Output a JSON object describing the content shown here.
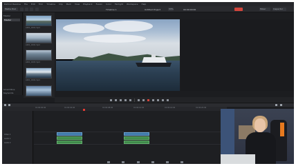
{
  "window": {
    "title": "DaVinci Resolve"
  },
  "menubar": {
    "items": [
      "DaVinci Resolve",
      "File",
      "Edit",
      "Trim",
      "Timeline",
      "Clip",
      "Mark",
      "View",
      "Playback",
      "Fusion",
      "Color",
      "Fairlight",
      "Workspace",
      "Help"
    ]
  },
  "toolbar": {
    "media_pool": "Media Pool",
    "project_title": "Untitled Project",
    "timeline_name": "Timeline 1",
    "zoom": "33%",
    "timecode_top": "00:00:00:00",
    "inspector": "Inspector",
    "mixer": "Mixer"
  },
  "left_panel": {
    "master_label": "Master",
    "items": [
      "Master"
    ],
    "smart_bins_label": "Smart Bins",
    "smart_items": [
      "Keywords",
      "Collections"
    ]
  },
  "bin": {
    "clips": [
      {
        "label": "A001_C001.mp4"
      },
      {
        "label": "A001_C002.mp4"
      },
      {
        "label": "A001_C003.mp4"
      },
      {
        "label": "A001_C004.mp4"
      },
      {
        "label": "A001_C005.mp4"
      }
    ]
  },
  "timeline": {
    "timecode": "01:00:00:00",
    "ruler_labels": [
      "01:00:00:00",
      "01:00:04:00",
      "01:00:08:00",
      "01:00:12:00",
      "01:00:16:00",
      "01:00:20:00"
    ],
    "tracks": [
      {
        "name": "V1",
        "label": "Video 1"
      },
      {
        "name": "A1",
        "label": "Audio 1"
      },
      {
        "name": "A2",
        "label": "Audio 2"
      }
    ]
  },
  "colors": {
    "accent": "#d3453b",
    "video_clip": "#3f78a8",
    "audio_clip": "#3f8a4a",
    "playhead": "#e23c34"
  },
  "icons": [
    "media-pool-icon",
    "play-icon",
    "stop-icon",
    "rewind-icon",
    "fast-forward-icon",
    "loop-icon",
    "blade-icon",
    "selection-icon"
  ]
}
